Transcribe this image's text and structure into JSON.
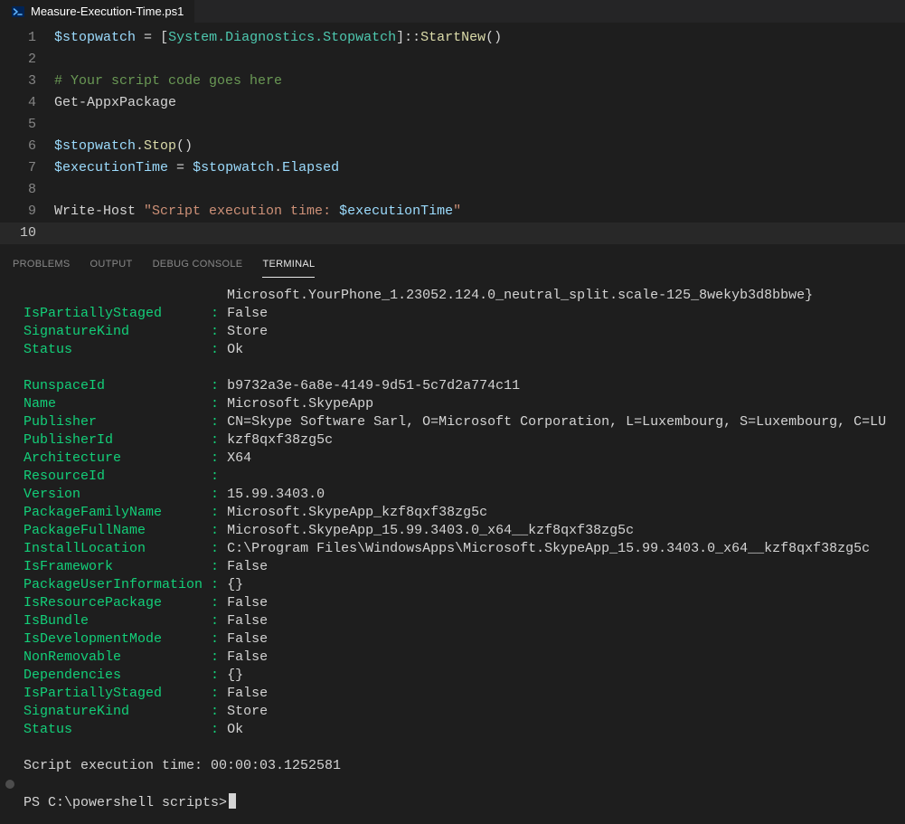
{
  "tab": {
    "filename": "Measure-Execution-Time.ps1"
  },
  "code": {
    "lines": [
      {
        "n": "1",
        "html": "var:$stopwatch| |op:=| |bracket:[|type:System.Diagnostics.Stopwatch|bracket:]|op:::|func:StartNew|paren:()"
      },
      {
        "n": "2",
        "html": ""
      },
      {
        "n": "3",
        "html": "comment:# Your script code goes here"
      },
      {
        "n": "4",
        "html": "cmd:Get-AppxPackage"
      },
      {
        "n": "5",
        "html": ""
      },
      {
        "n": "6",
        "html": "var:$stopwatch|op:.|func:Stop|paren:()"
      },
      {
        "n": "7",
        "html": "var:$executionTime| |op:=| |var:$stopwatch|op:.|var:Elapsed"
      },
      {
        "n": "8",
        "html": ""
      },
      {
        "n": "9",
        "html": "cmd:Write-Host| |string:\"Script execution time: |var:$executionTime|string:\""
      },
      {
        "n": "10",
        "html": "",
        "active": true
      }
    ]
  },
  "panel": {
    "tabs": {
      "problems": "PROBLEMS",
      "output": "OUTPUT",
      "debug": "DEBUG CONSOLE",
      "terminal": "TERMINAL"
    }
  },
  "terminal": {
    "preline": "Microsoft.YourPhone_1.23052.124.0_neutral_split.scale-125_8wekyb3d8bbwe}",
    "block1": [
      {
        "k": "IsPartiallyStaged",
        "v": "False"
      },
      {
        "k": "SignatureKind",
        "v": "Store"
      },
      {
        "k": "Status",
        "v": "Ok"
      }
    ],
    "block2": [
      {
        "k": "RunspaceId",
        "v": "b9732a3e-6a8e-4149-9d51-5c7d2a774c11"
      },
      {
        "k": "Name",
        "v": "Microsoft.SkypeApp"
      },
      {
        "k": "Publisher",
        "v": "CN=Skype Software Sarl, O=Microsoft Corporation, L=Luxembourg, S=Luxembourg, C=LU"
      },
      {
        "k": "PublisherId",
        "v": "kzf8qxf38zg5c"
      },
      {
        "k": "Architecture",
        "v": "X64"
      },
      {
        "k": "ResourceId",
        "v": ""
      },
      {
        "k": "Version",
        "v": "15.99.3403.0"
      },
      {
        "k": "PackageFamilyName",
        "v": "Microsoft.SkypeApp_kzf8qxf38zg5c"
      },
      {
        "k": "PackageFullName",
        "v": "Microsoft.SkypeApp_15.99.3403.0_x64__kzf8qxf38zg5c"
      },
      {
        "k": "InstallLocation",
        "v": "C:\\Program Files\\WindowsApps\\Microsoft.SkypeApp_15.99.3403.0_x64__kzf8qxf38zg5c"
      },
      {
        "k": "IsFramework",
        "v": "False"
      },
      {
        "k": "PackageUserInformation",
        "v": "{}"
      },
      {
        "k": "IsResourcePackage",
        "v": "False"
      },
      {
        "k": "IsBundle",
        "v": "False"
      },
      {
        "k": "IsDevelopmentMode",
        "v": "False"
      },
      {
        "k": "NonRemovable",
        "v": "False"
      },
      {
        "k": "Dependencies",
        "v": "{}"
      },
      {
        "k": "IsPartiallyStaged",
        "v": "False"
      },
      {
        "k": "SignatureKind",
        "v": "Store"
      },
      {
        "k": "Status",
        "v": "Ok"
      }
    ],
    "footer": "Script execution time: 00:00:03.1252581",
    "prompt": "PS C:\\powershell scripts>"
  },
  "keyWidth": 22
}
